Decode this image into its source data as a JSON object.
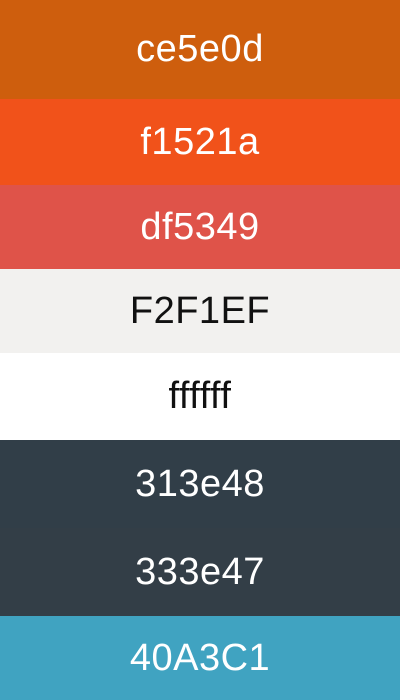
{
  "swatches": [
    {
      "label": "ce5e0d",
      "color": "#ce5e0d",
      "text_color": "#ffffff"
    },
    {
      "label": "f1521a",
      "color": "#f1521a",
      "text_color": "#ffffff"
    },
    {
      "label": "df5349",
      "color": "#df5349",
      "text_color": "#ffffff"
    },
    {
      "label": "F2F1EF",
      "color": "#F2F1EF",
      "text_color": "#111111"
    },
    {
      "label": "ffffff",
      "color": "#ffffff",
      "text_color": "#111111"
    },
    {
      "label": "313e48",
      "color": "#313e48",
      "text_color": "#ffffff"
    },
    {
      "label": "333e47",
      "color": "#333e47",
      "text_color": "#ffffff"
    },
    {
      "label": "40A3C1",
      "color": "#40A3C1",
      "text_color": "#ffffff"
    }
  ]
}
